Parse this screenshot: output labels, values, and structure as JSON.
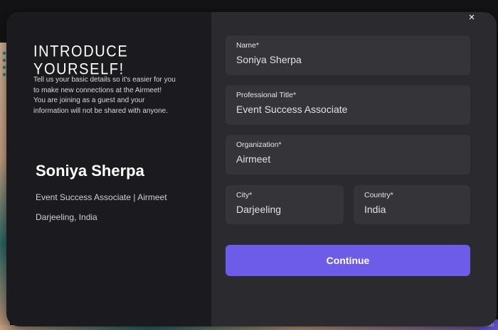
{
  "modal": {
    "heading": "INTRODUCE YOURSELF!",
    "intro_lines": [
      "Tell us your basic details so it's easier for you",
      "to make new connections at the Airmeet!",
      "You are joining as a guest and your",
      "information will not be shared with anyone."
    ],
    "close_icon": "×"
  },
  "preview": {
    "name": "Soniya Sherpa",
    "title_line": "Event Success Associate | Airmeet",
    "location_line": "Darjeeling, India"
  },
  "form": {
    "name": {
      "label": "Name*",
      "value": "Soniya Sherpa"
    },
    "title": {
      "label": "Professional Title*",
      "value": "Event Success Associate"
    },
    "organization": {
      "label": "Organization*",
      "value": "Airmeet"
    },
    "city": {
      "label": "City*",
      "value": "Darjeeling"
    },
    "country": {
      "label": "Country*",
      "value": "India"
    },
    "submit_label": "Continue"
  },
  "background": {
    "corner_text": "Ente"
  },
  "colors": {
    "accent": "#6d5ce8",
    "left_panel": "#1b1b1f",
    "right_panel": "#2a2a2f",
    "field_bg": "#353539"
  }
}
